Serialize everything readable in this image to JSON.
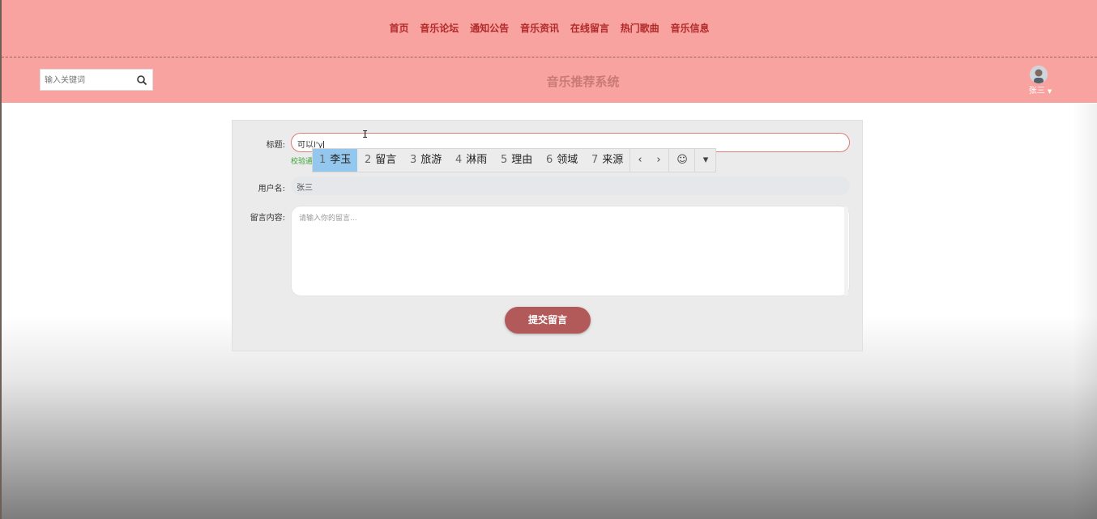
{
  "nav": {
    "items": [
      "首页",
      "音乐论坛",
      "通知公告",
      "音乐资讯",
      "在线留言",
      "热门歌曲",
      "音乐信息"
    ]
  },
  "header": {
    "search_placeholder": "输入关键词",
    "site_title": "音乐推荐系统",
    "username": "张三"
  },
  "form": {
    "title_label": "标题:",
    "title_value": "可以l'y",
    "hint_text": "校验通",
    "username_label": "用户名:",
    "username_value": "张三",
    "content_label": "留言内容:",
    "content_placeholder": "请输入你的留言...",
    "submit_label": "提交留言"
  },
  "ime": {
    "candidates": [
      {
        "num": "1",
        "text": "李玉"
      },
      {
        "num": "2",
        "text": "留言"
      },
      {
        "num": "3",
        "text": "旅游"
      },
      {
        "num": "4",
        "text": "淋雨"
      },
      {
        "num": "5",
        "text": "理由"
      },
      {
        "num": "6",
        "text": "领域"
      },
      {
        "num": "7",
        "text": "来源"
      }
    ],
    "prev": "‹",
    "next": "›",
    "emoji": "☺",
    "more": "▾"
  },
  "colors": {
    "header_bg": "#f9a3a1",
    "nav_text": "#b02a2a",
    "accent_button": "#b25a59",
    "ime_selected": "#94c7ee"
  }
}
